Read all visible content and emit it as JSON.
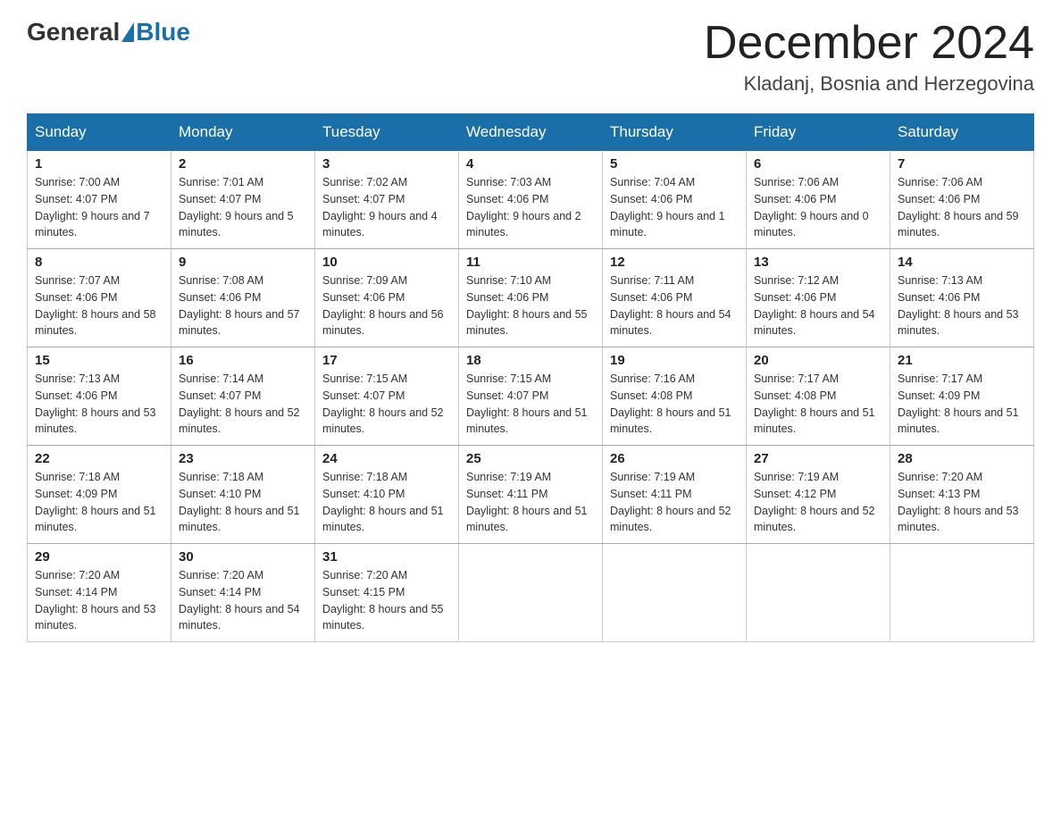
{
  "header": {
    "logo_general": "General",
    "logo_blue": "Blue",
    "month_title": "December 2024",
    "location": "Kladanj, Bosnia and Herzegovina"
  },
  "days_of_week": [
    "Sunday",
    "Monday",
    "Tuesday",
    "Wednesday",
    "Thursday",
    "Friday",
    "Saturday"
  ],
  "weeks": [
    [
      {
        "day": "1",
        "sunrise": "7:00 AM",
        "sunset": "4:07 PM",
        "daylight": "9 hours and 7 minutes."
      },
      {
        "day": "2",
        "sunrise": "7:01 AM",
        "sunset": "4:07 PM",
        "daylight": "9 hours and 5 minutes."
      },
      {
        "day": "3",
        "sunrise": "7:02 AM",
        "sunset": "4:07 PM",
        "daylight": "9 hours and 4 minutes."
      },
      {
        "day": "4",
        "sunrise": "7:03 AM",
        "sunset": "4:06 PM",
        "daylight": "9 hours and 2 minutes."
      },
      {
        "day": "5",
        "sunrise": "7:04 AM",
        "sunset": "4:06 PM",
        "daylight": "9 hours and 1 minute."
      },
      {
        "day": "6",
        "sunrise": "7:06 AM",
        "sunset": "4:06 PM",
        "daylight": "9 hours and 0 minutes."
      },
      {
        "day": "7",
        "sunrise": "7:06 AM",
        "sunset": "4:06 PM",
        "daylight": "8 hours and 59 minutes."
      }
    ],
    [
      {
        "day": "8",
        "sunrise": "7:07 AM",
        "sunset": "4:06 PM",
        "daylight": "8 hours and 58 minutes."
      },
      {
        "day": "9",
        "sunrise": "7:08 AM",
        "sunset": "4:06 PM",
        "daylight": "8 hours and 57 minutes."
      },
      {
        "day": "10",
        "sunrise": "7:09 AM",
        "sunset": "4:06 PM",
        "daylight": "8 hours and 56 minutes."
      },
      {
        "day": "11",
        "sunrise": "7:10 AM",
        "sunset": "4:06 PM",
        "daylight": "8 hours and 55 minutes."
      },
      {
        "day": "12",
        "sunrise": "7:11 AM",
        "sunset": "4:06 PM",
        "daylight": "8 hours and 54 minutes."
      },
      {
        "day": "13",
        "sunrise": "7:12 AM",
        "sunset": "4:06 PM",
        "daylight": "8 hours and 54 minutes."
      },
      {
        "day": "14",
        "sunrise": "7:13 AM",
        "sunset": "4:06 PM",
        "daylight": "8 hours and 53 minutes."
      }
    ],
    [
      {
        "day": "15",
        "sunrise": "7:13 AM",
        "sunset": "4:06 PM",
        "daylight": "8 hours and 53 minutes."
      },
      {
        "day": "16",
        "sunrise": "7:14 AM",
        "sunset": "4:07 PM",
        "daylight": "8 hours and 52 minutes."
      },
      {
        "day": "17",
        "sunrise": "7:15 AM",
        "sunset": "4:07 PM",
        "daylight": "8 hours and 52 minutes."
      },
      {
        "day": "18",
        "sunrise": "7:15 AM",
        "sunset": "4:07 PM",
        "daylight": "8 hours and 51 minutes."
      },
      {
        "day": "19",
        "sunrise": "7:16 AM",
        "sunset": "4:08 PM",
        "daylight": "8 hours and 51 minutes."
      },
      {
        "day": "20",
        "sunrise": "7:17 AM",
        "sunset": "4:08 PM",
        "daylight": "8 hours and 51 minutes."
      },
      {
        "day": "21",
        "sunrise": "7:17 AM",
        "sunset": "4:09 PM",
        "daylight": "8 hours and 51 minutes."
      }
    ],
    [
      {
        "day": "22",
        "sunrise": "7:18 AM",
        "sunset": "4:09 PM",
        "daylight": "8 hours and 51 minutes."
      },
      {
        "day": "23",
        "sunrise": "7:18 AM",
        "sunset": "4:10 PM",
        "daylight": "8 hours and 51 minutes."
      },
      {
        "day": "24",
        "sunrise": "7:18 AM",
        "sunset": "4:10 PM",
        "daylight": "8 hours and 51 minutes."
      },
      {
        "day": "25",
        "sunrise": "7:19 AM",
        "sunset": "4:11 PM",
        "daylight": "8 hours and 51 minutes."
      },
      {
        "day": "26",
        "sunrise": "7:19 AM",
        "sunset": "4:11 PM",
        "daylight": "8 hours and 52 minutes."
      },
      {
        "day": "27",
        "sunrise": "7:19 AM",
        "sunset": "4:12 PM",
        "daylight": "8 hours and 52 minutes."
      },
      {
        "day": "28",
        "sunrise": "7:20 AM",
        "sunset": "4:13 PM",
        "daylight": "8 hours and 53 minutes."
      }
    ],
    [
      {
        "day": "29",
        "sunrise": "7:20 AM",
        "sunset": "4:14 PM",
        "daylight": "8 hours and 53 minutes."
      },
      {
        "day": "30",
        "sunrise": "7:20 AM",
        "sunset": "4:14 PM",
        "daylight": "8 hours and 54 minutes."
      },
      {
        "day": "31",
        "sunrise": "7:20 AM",
        "sunset": "4:15 PM",
        "daylight": "8 hours and 55 minutes."
      },
      null,
      null,
      null,
      null
    ]
  ],
  "labels": {
    "sunrise": "Sunrise:",
    "sunset": "Sunset:",
    "daylight": "Daylight:"
  }
}
